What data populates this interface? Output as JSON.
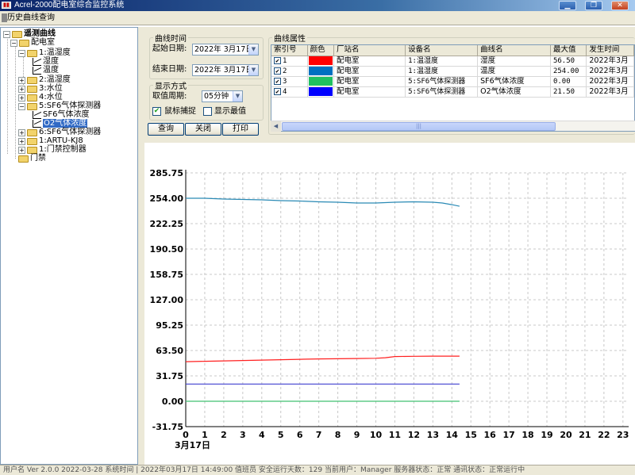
{
  "window": {
    "title": "Acrel-2000配电室综合监控系统",
    "min": "▁",
    "restore": "❐",
    "close": "✕"
  },
  "menu": {
    "items": [
      "历史曲线查询"
    ]
  },
  "tree": {
    "nodes": [
      {
        "label": "遥测曲线",
        "exp": "−",
        "icon": "folder",
        "bold": true
      },
      {
        "label": "配电室",
        "exp": "−",
        "icon": "folder"
      },
      {
        "label": "1:温湿度",
        "exp": "−",
        "icon": "folder"
      },
      {
        "label": "湿度",
        "icon": "chart"
      },
      {
        "label": "温度",
        "icon": "chart"
      },
      {
        "label": "2:温湿度",
        "exp": "+",
        "icon": "folder"
      },
      {
        "label": "3:水位",
        "exp": "+",
        "icon": "folder"
      },
      {
        "label": "4:水位",
        "exp": "+",
        "icon": "folder"
      },
      {
        "label": "5:SF6气体探测器",
        "exp": "−",
        "icon": "folder"
      },
      {
        "label": "SF6气体浓度",
        "icon": "chart"
      },
      {
        "label": "O2气体浓度",
        "icon": "chart",
        "selected": true
      },
      {
        "label": "6:SF6气体探测器",
        "exp": "+",
        "icon": "folder"
      },
      {
        "label": "1:ARTU-KJ8",
        "exp": "+",
        "icon": "folder"
      },
      {
        "label": "1:门禁控制器",
        "exp": "+",
        "icon": "folder"
      },
      {
        "label": "门禁",
        "icon": "folder"
      }
    ]
  },
  "query": {
    "time_group": "曲线时间",
    "start_label": "起始日期:",
    "start_value": "2022年 3月17日",
    "end_label": "结束日期:",
    "end_value": "2022年 3月17日",
    "mode_group": "显示方式",
    "period_label": "取值周期:",
    "period_value": "05分钟",
    "mouse_capture_label": "鼠标捕捉",
    "mouse_capture_checked": true,
    "show_max_label": "显示最值",
    "show_max_checked": false,
    "query_button": "查询",
    "close_button": "关闭",
    "print_button": "打印"
  },
  "grid": {
    "group": "曲线属性",
    "columns": [
      "索引号",
      "颜色",
      "厂站名",
      "设备名",
      "曲线名",
      "最大值",
      "发生时间"
    ],
    "rows": [
      {
        "index": "1",
        "color": "#ff0000",
        "station": "配电室",
        "device": "1:温湿度",
        "curve": "湿度",
        "max": "56.50",
        "time": "2022年3月"
      },
      {
        "index": "2",
        "color": "#0070c0",
        "station": "配电室",
        "device": "1:温湿度",
        "curve": "温度",
        "max": "254.00",
        "time": "2022年3月"
      },
      {
        "index": "3",
        "color": "#20c060",
        "station": "配电室",
        "device": "5:SF6气体探测器",
        "curve": "SF6气体浓度",
        "max": "0.00",
        "time": "2022年3月"
      },
      {
        "index": "4",
        "color": "#0000ff",
        "station": "配电室",
        "device": "5:SF6气体探测器",
        "curve": "O2气体浓度",
        "max": "21.50",
        "time": "2022年3月"
      }
    ],
    "scroll_grip": "|||"
  },
  "chart_data": {
    "type": "line",
    "ylim": [
      -31.75,
      285.75
    ],
    "y_ticks": [
      "285.75",
      "254.00",
      "222.25",
      "190.50",
      "158.75",
      "127.00",
      "95.25",
      "63.50",
      "31.75",
      "0.00",
      "-31.75"
    ],
    "x_ticks": [
      "0",
      "1",
      "2",
      "3",
      "4",
      "5",
      "6",
      "7",
      "8",
      "9",
      "10",
      "11",
      "12",
      "13",
      "14",
      "15",
      "16",
      "17",
      "18",
      "19",
      "20",
      "21",
      "22",
      "23"
    ],
    "x_date_label": "3月17日",
    "xlim": [
      0,
      23.3
    ],
    "grid": true,
    "series": [
      {
        "color": "#2a8ab5",
        "x": [
          0,
          1,
          2,
          3,
          4,
          5,
          6,
          7,
          8,
          9,
          10,
          10.5,
          11,
          12,
          13,
          13.5,
          14,
          14.4
        ],
        "y": [
          254,
          254,
          253,
          252.5,
          252,
          251,
          250.5,
          249.5,
          249,
          248,
          248,
          248.5,
          249,
          249.5,
          249,
          248,
          246,
          244
        ]
      },
      {
        "color": "#ff2020",
        "x": [
          0,
          1,
          2,
          3,
          4,
          5,
          6,
          7,
          8,
          9,
          10,
          10.5,
          11,
          12,
          13,
          14,
          14.4
        ],
        "y": [
          49.5,
          50,
          50.5,
          51,
          51.5,
          52,
          52.5,
          53,
          53.2,
          53.5,
          53.8,
          54.5,
          56,
          56.3,
          56.5,
          56.5,
          56.5
        ]
      },
      {
        "color": "#4040d0",
        "x": [
          0,
          14.4
        ],
        "y": [
          21.5,
          21.5
        ]
      },
      {
        "color": "#40c070",
        "x": [
          0,
          14.4
        ],
        "y": [
          0,
          0
        ]
      }
    ]
  },
  "status": {
    "text": "用户名    Ver 2.0.0 2022-03-28    系统时间 | 2022年03月17日 14:49:00    值班员    安全运行天数：129    当前用户：Manager    服务器状态：正常    通讯状态：正常运行中"
  }
}
